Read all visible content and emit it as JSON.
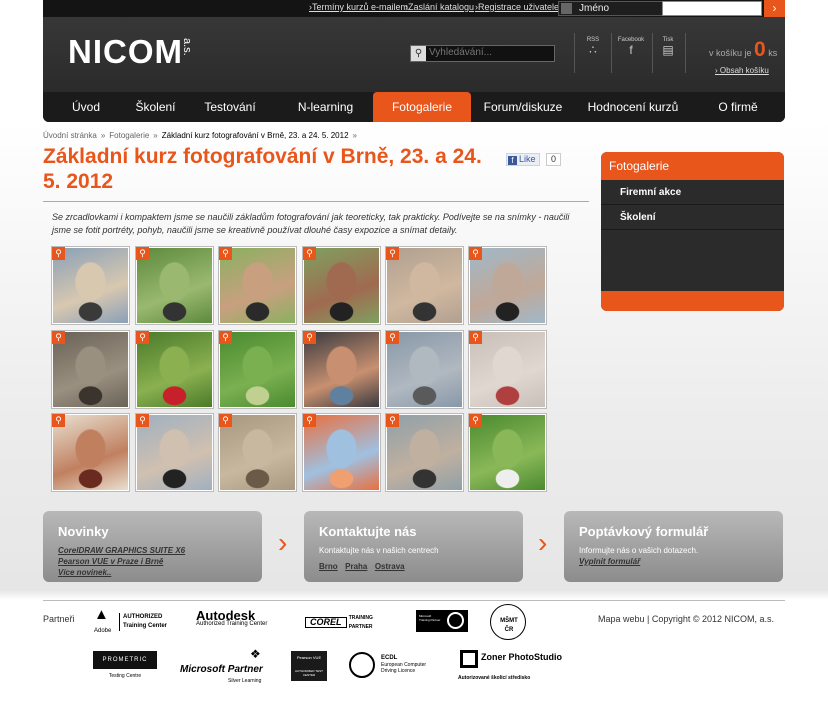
{
  "topbar": {
    "links": [
      "Termíny kurzů e-mailem",
      "Zaslání katalogu",
      "Registrace uživatele"
    ],
    "user_label": "Jméno",
    "login_button": "›"
  },
  "header": {
    "logo": "NICOM",
    "logo_suffix": "a.s.",
    "search_placeholder": "Vyhledávání...",
    "social": [
      {
        "label": "RSS",
        "icon": "rss-icon"
      },
      {
        "label": "Facebook",
        "icon": "facebook-icon"
      },
      {
        "label": "Tisk",
        "icon": "print-icon"
      }
    ],
    "cart_text": "v košíku je",
    "cart_count": "0",
    "cart_unit": "ks",
    "cart_link": "Obsah košíku"
  },
  "nav": {
    "items": [
      "Úvod",
      "Školení",
      "Testování",
      "N-learning",
      "Fotogalerie",
      "Forum/diskuze",
      "Hodnocení kurzů",
      "O firmě"
    ],
    "active": "Fotogalerie"
  },
  "breadcrumb": [
    "Úvodní stránka",
    "Fotogalerie",
    "Základní kurz fotografování v Brně, 23. a 24. 5. 2012"
  ],
  "page": {
    "title": "Základní kurz fotografování v Brně, 23. a 24. 5. 2012",
    "like_label": "Like",
    "like_count": "0",
    "intro": "Se zrcadlovkami i kompaktem jsme se naučili základům fotografování jak teoreticky, tak prakticky. Podívejte se na snímky - naučili jsme se fotit portréty, pohyb, naučili jsme se kreativně používat dlouhé časy expozice a snímat detaily."
  },
  "gallery": {
    "zoom_icon": "magnifier-icon",
    "photos": [
      {
        "subject": "people-shoes",
        "colors": [
          "#8aa0b8",
          "#d8c8b0",
          "#3a3a3a"
        ]
      },
      {
        "subject": "jumping-person",
        "colors": [
          "#5c8a3c",
          "#9ab870",
          "#333"
        ]
      },
      {
        "subject": "woman-portrait",
        "colors": [
          "#8ab060",
          "#c8a080",
          "#2a2a2a"
        ]
      },
      {
        "subject": "woman-with-camera",
        "colors": [
          "#7fa060",
          "#a06a50",
          "#222"
        ]
      },
      {
        "subject": "photographer-pose",
        "colors": [
          "#b0a090",
          "#d0b8a0",
          "#333"
        ]
      },
      {
        "subject": "woman-sunglasses",
        "colors": [
          "#a0b8c8",
          "#c0a898",
          "#222"
        ]
      },
      {
        "subject": "pebbles",
        "colors": [
          "#6a6258",
          "#9a9080",
          "#3a342c"
        ]
      },
      {
        "subject": "red-flower",
        "colors": [
          "#4a7a2a",
          "#8ab050",
          "#c8202a"
        ]
      },
      {
        "subject": "grass-detail",
        "colors": [
          "#4a8a30",
          "#7ab050",
          "#c0d090"
        ]
      },
      {
        "subject": "man-portrait",
        "colors": [
          "#3a3a40",
          "#c89070",
          "#6080a0"
        ]
      },
      {
        "subject": "street-blur",
        "colors": [
          "#8898a8",
          "#b0b8c0",
          "#5a5a5a"
        ]
      },
      {
        "subject": "tram-motion",
        "colors": [
          "#c8c0b8",
          "#e0d8d0",
          "#b04040"
        ]
      },
      {
        "subject": "young-man",
        "colors": [
          "#e8e0d0",
          "#c08060",
          "#6a2a20"
        ]
      },
      {
        "subject": "man-with-camera",
        "colors": [
          "#a0b0c0",
          "#d0c0b0",
          "#222"
        ]
      },
      {
        "subject": "bark-detail",
        "colors": [
          "#a89880",
          "#c8b8a0",
          "#6a5a48"
        ]
      },
      {
        "subject": "orange-building",
        "colors": [
          "#e87040",
          "#a0c0e0",
          "#f0a070"
        ]
      },
      {
        "subject": "group-photographers",
        "colors": [
          "#90a0a8",
          "#c0b0a0",
          "#333"
        ]
      },
      {
        "subject": "group-on-grass",
        "colors": [
          "#4a8a30",
          "#8ab858",
          "#eee"
        ]
      }
    ]
  },
  "sidebar": {
    "title": "Fotogalerie",
    "items": [
      "Firemní akce",
      "Školení"
    ]
  },
  "boxes": [
    {
      "title": "Novinky",
      "links": [
        "CorelDRAW GRAPHICS SUITE X6",
        "Pearson VUE v Praze i Brně",
        "Více novinek.."
      ]
    },
    {
      "title": "Kontaktujte nás",
      "text": "Kontaktujte nás v našich centrech",
      "links": [
        "Brno",
        "Praha",
        "Ostrava"
      ]
    },
    {
      "title": "Poptávkový formulář",
      "text": "Informujte nás o vašich dotazech.",
      "links": [
        "Vyplnit formulář"
      ]
    }
  ],
  "footer": {
    "partners_label": "Partneři",
    "copyright": "Mapa webu | Copyright © 2012 NICOM, a.s.",
    "logos": [
      {
        "name": "Adobe",
        "text": "AUTHORIZED Training Center"
      },
      {
        "name": "Autodesk",
        "text": "Authorized Training Center"
      },
      {
        "name": "COREL",
        "text": "TRAINING PARTNER"
      },
      {
        "name": "Microsoft Training Partner"
      },
      {
        "name": "MŠMT ČR"
      },
      {
        "name": "PROMETRIC",
        "text": "Testing Centre"
      },
      {
        "name": "Microsoft Partner",
        "text": "Silver Learning"
      },
      {
        "name": "Pearson VUE",
        "text": "AUTHORIZED TEST CENTER"
      },
      {
        "name": "ECDL",
        "text": "European Computer Driving Licence"
      },
      {
        "name": "Zoner PhotoStudio",
        "text": "Autorizované školicí středisko"
      }
    ]
  }
}
